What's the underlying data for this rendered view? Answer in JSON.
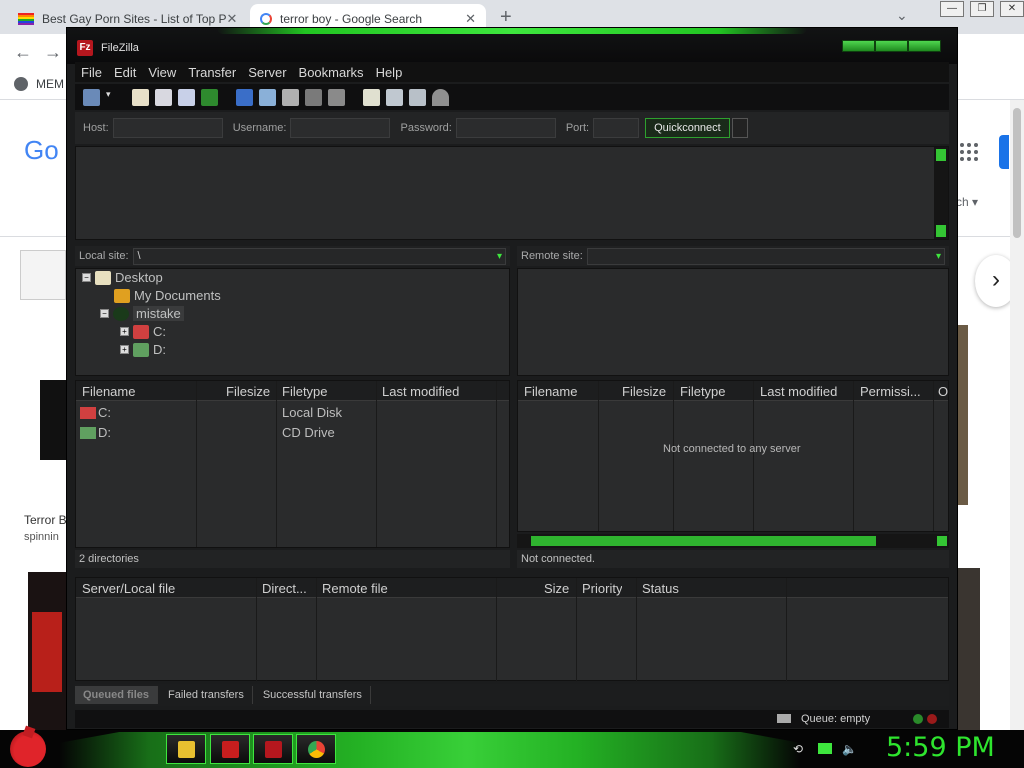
{
  "browser": {
    "tabs": [
      {
        "title": "Best Gay Porn Sites - List of Top P",
        "close": "✕"
      },
      {
        "title": "terror boy - Google Search",
        "close": "✕"
      }
    ],
    "new_tab": "+",
    "bookmark_label": "MEM",
    "google_logo": "Go",
    "search_right_label": "rch ▾",
    "result_title": "Terror B",
    "result_sub": "spinnin",
    "next_arrow": "›"
  },
  "window_controls": {
    "minimize": "—",
    "maximize": "❐",
    "close": "✕"
  },
  "filezilla": {
    "title": "FileZilla",
    "logo": "Fz",
    "menu": [
      "File",
      "Edit",
      "View",
      "Transfer",
      "Server",
      "Bookmarks",
      "Help"
    ],
    "quickconnect": {
      "host_label": "Host:",
      "username_label": "Username:",
      "password_label": "Password:",
      "port_label": "Port:",
      "button": "Quickconnect"
    },
    "local_site_label": "Local site:",
    "local_site_value": "\\",
    "remote_site_label": "Remote site:",
    "remote_site_value": "",
    "tree": [
      {
        "label": "Desktop",
        "expander": "−"
      },
      {
        "label": "My Documents",
        "expander": ""
      },
      {
        "label": "mistake",
        "expander": "−"
      },
      {
        "label": "C:",
        "expander": "+"
      },
      {
        "label": "D:",
        "expander": "+"
      }
    ],
    "local_columns": [
      "Filename",
      "Filesize",
      "Filetype",
      "Last modified"
    ],
    "local_files": [
      {
        "name": "C:",
        "type": "Local Disk"
      },
      {
        "name": "D:",
        "type": "CD Drive"
      }
    ],
    "local_status": "2 directories",
    "remote_columns": [
      "Filename",
      "Filesize",
      "Filetype",
      "Last modified",
      "Permissi...",
      "O"
    ],
    "remote_empty": "Not connected to any server",
    "remote_status": "Not connected.",
    "queue_columns": [
      "Server/Local file",
      "Direct...",
      "Remote file",
      "Size",
      "Priority",
      "Status"
    ],
    "queue_tabs": [
      "Queued files",
      "Failed transfers",
      "Successful transfers"
    ],
    "queue_status": "Queue: empty"
  },
  "taskbar": {
    "clock": "5:59 PM"
  },
  "colors": {
    "accent_green": "#3ee63e",
    "panel_bg": "#2a2b2c",
    "chrome_tabstrip": "#dee1e6"
  }
}
